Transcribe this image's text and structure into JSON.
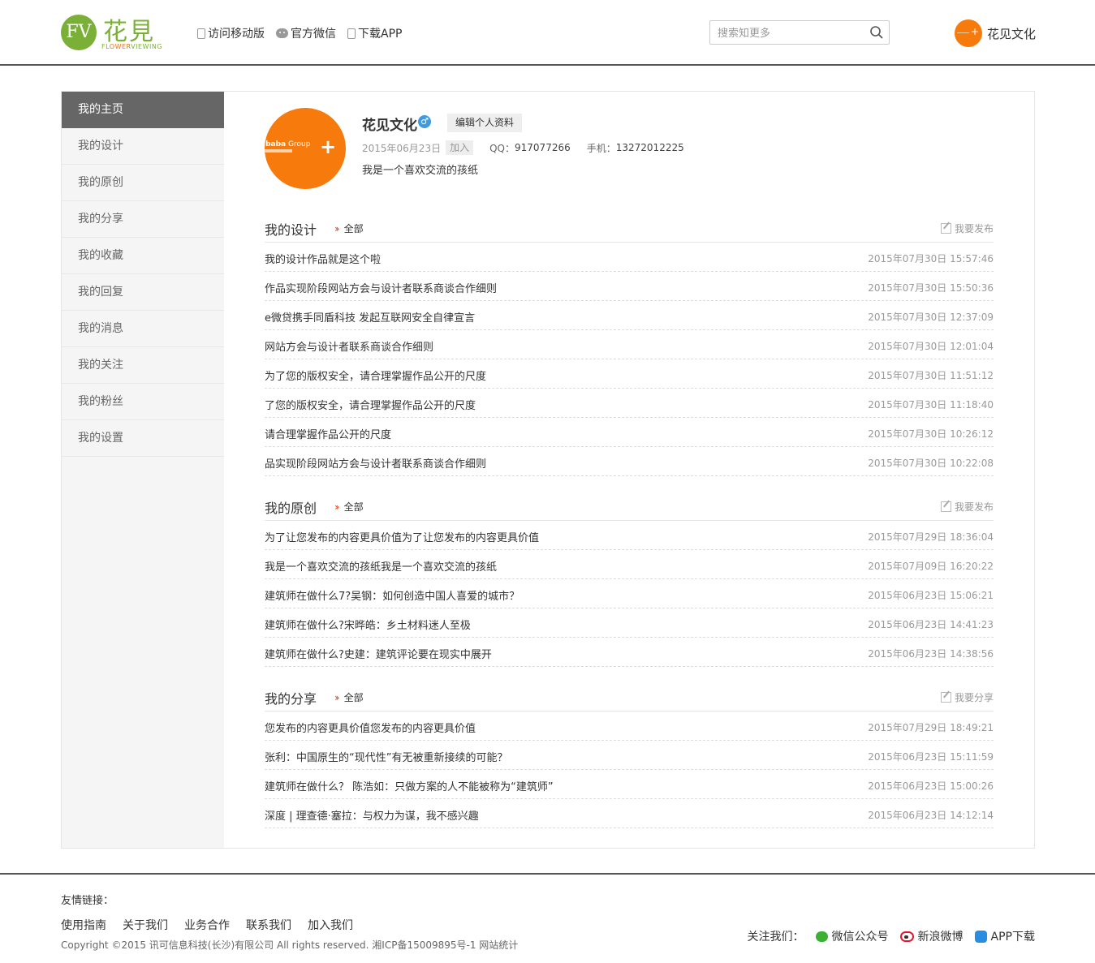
{
  "header": {
    "logo_badge": "FV",
    "logo_cn": "花見",
    "logo_en_pre": "F",
    "logo_en_mid": "LOWER",
    "logo_en_post": "VIEWING",
    "nav": [
      "访问移动版",
      "官方微信",
      "下载APP"
    ],
    "search_placeholder": "搜索知更多",
    "user_name": "花见文化"
  },
  "sidebar": {
    "items": [
      "我的主页",
      "我的设计",
      "我的原创",
      "我的分享",
      "我的收藏",
      "我的回复",
      "我的消息",
      "我的关注",
      "我的粉丝",
      "我的设置"
    ],
    "active_index": 0
  },
  "profile": {
    "name": "花见文化",
    "gender_icon": "♂",
    "edit_label": "编辑个人资料",
    "join_date": "2015年06月23日",
    "join_label": "加入",
    "qq_label": "QQ：",
    "qq": "917077266",
    "phone_label": "手机：",
    "phone": "13272012225",
    "bio": "我是一个喜欢交流的孩纸",
    "avatar_text": "ibaba",
    "avatar_text2": " Group"
  },
  "sections": {
    "design": {
      "title": "我的设计",
      "all_label": "全部",
      "publish_label": "我要发布",
      "rows": [
        {
          "title": "我的设计作品就是这个啦",
          "date": "2015年07月30日 15:57:46"
        },
        {
          "title": "作品实现阶段网站方会与设计者联系商谈合作细则",
          "date": "2015年07月30日 15:50:36"
        },
        {
          "title": "e微贷携手同盾科技 发起互联网安全自律宣言",
          "date": "2015年07月30日 12:37:09"
        },
        {
          "title": "网站方会与设计者联系商谈合作细则",
          "date": "2015年07月30日 12:01:04"
        },
        {
          "title": "为了您的版权安全，请合理掌握作品公开的尺度",
          "date": "2015年07月30日 11:51:12"
        },
        {
          "title": "了您的版权安全，请合理掌握作品公开的尺度",
          "date": "2015年07月30日 11:18:40"
        },
        {
          "title": "请合理掌握作品公开的尺度",
          "date": "2015年07月30日 10:26:12"
        },
        {
          "title": "品实现阶段网站方会与设计者联系商谈合作细则",
          "date": "2015年07月30日 10:22:08"
        }
      ]
    },
    "original": {
      "title": "我的原创",
      "all_label": "全部",
      "publish_label": "我要发布",
      "rows": [
        {
          "title": "为了让您发布的内容更具价值为了让您发布的内容更具价值",
          "date": "2015年07月29日 18:36:04"
        },
        {
          "title": "我是一个喜欢交流的孩纸我是一个喜欢交流的孩纸",
          "date": "2015年07月09日 16:20:22"
        },
        {
          "title": "建筑师在做什么7?吴钢：如何创造中国人喜爱的城市？",
          "date": "2015年06月23日 15:06:21"
        },
        {
          "title": "建筑师在做什么?宋晔皓：乡土材料迷人至极",
          "date": "2015年06月23日 14:41:23"
        },
        {
          "title": "建筑师在做什么?史建：建筑评论要在现实中展开",
          "date": "2015年06月23日 14:38:56"
        }
      ]
    },
    "share": {
      "title": "我的分享",
      "all_label": "全部",
      "publish_label": "我要分享",
      "rows": [
        {
          "title": "您发布的内容更具价值您发布的内容更具价值",
          "date": "2015年07月29日 18:49:21"
        },
        {
          "title": "张利：中国原生的“现代性”有无被重新接续的可能？",
          "date": "2015年06月23日 15:11:59"
        },
        {
          "title": "建筑师在做什么？ 陈浩如：只做方案的人不能被称为“建筑师”",
          "date": "2015年06月23日 15:00:26"
        },
        {
          "title": "深度 | 理查德·塞拉：与权力为谋，我不感兴趣",
          "date": "2015年06月23日 14:12:14"
        }
      ]
    }
  },
  "footer": {
    "links_label": "友情链接：",
    "nav": [
      "使用指南",
      "关于我们",
      "业务合作",
      "联系我们",
      "加入我们"
    ],
    "copyright": "Copyright ©2015 讯可信息科技(长沙)有限公司 All rights reserved. 湘ICP备15009895号-1 网站统计",
    "follow_label": "关注我们：",
    "follow": [
      "微信公众号",
      "新浪微博",
      "APP下载"
    ]
  },
  "colors": {
    "brand_green": "#7ab037",
    "avatar_orange": "#f77b0c",
    "accent_red": "#e5431c",
    "sidebar_active": "#666666"
  },
  "icons": [
    "phone-icon",
    "wechat-icon",
    "search-icon",
    "male-icon",
    "double-chevron-icon",
    "edit-pen-icon",
    "weibo-icon",
    "app-icon"
  ]
}
